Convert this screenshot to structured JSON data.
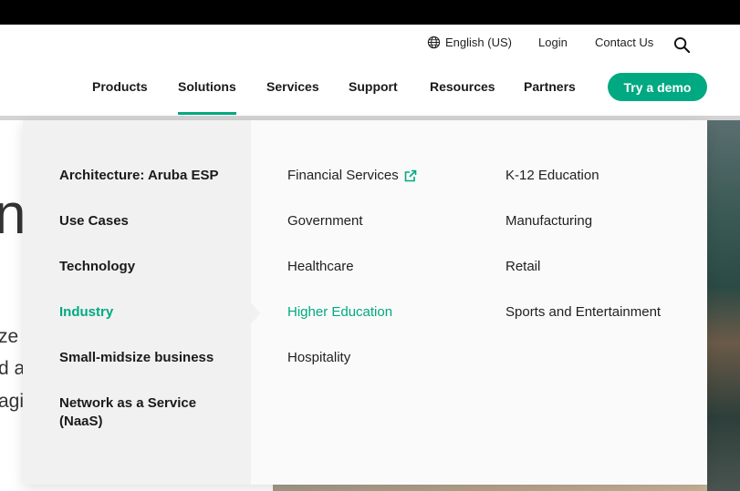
{
  "utility": {
    "language": "English (US)",
    "login": "Login",
    "contact": "Contact Us"
  },
  "nav": {
    "products": "Products",
    "solutions": "Solutions",
    "services": "Services",
    "support": "Support",
    "resources": "Resources",
    "partners": "Partners",
    "demo": "Try a demo"
  },
  "background": {
    "big": "n",
    "line1": "ze",
    "line2": "d a",
    "line3": "agi"
  },
  "menu": {
    "left": [
      "Architecture: Aruba ESP",
      "Use Cases",
      "Technology",
      "Industry",
      "Small-midsize business",
      "Network as a Service (NaaS)"
    ],
    "col1": [
      "Financial Services",
      "Government",
      "Healthcare",
      "Higher Education",
      "Hospitality"
    ],
    "col2": [
      "K-12 Education",
      "Manufacturing",
      "Retail",
      "Sports and Entertainment"
    ]
  },
  "colors": {
    "accent": "#01a982"
  }
}
